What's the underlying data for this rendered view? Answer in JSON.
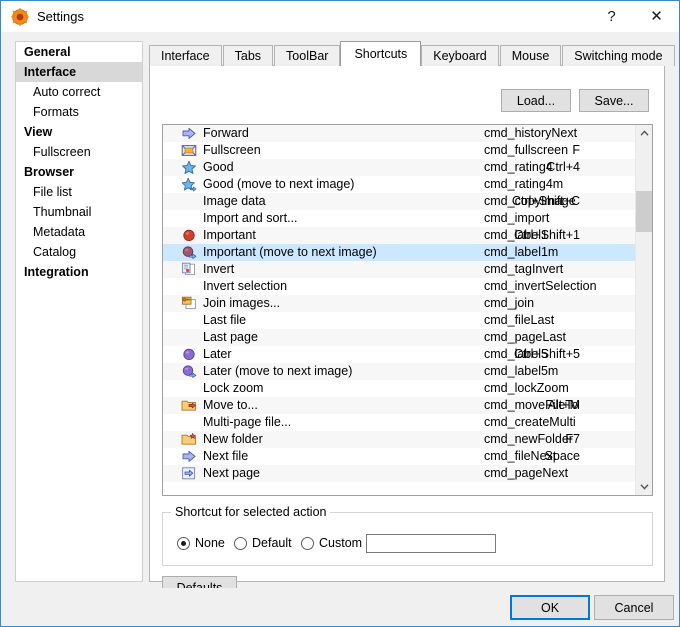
{
  "window": {
    "title": "Settings",
    "icon": "settings-gear-icon",
    "help_label": "?",
    "close_label": "✕",
    "accent": "#0078d7",
    "titlebar_bg": "#ffffff",
    "dialog_bg": "#f0f0f0"
  },
  "sidebar": {
    "items": [
      {
        "label": "General",
        "type": "category",
        "selected": false
      },
      {
        "label": "Interface",
        "type": "category",
        "selected": true
      },
      {
        "label": "Auto correct",
        "type": "child",
        "selected": false
      },
      {
        "label": "Formats",
        "type": "child",
        "selected": false
      },
      {
        "label": "View",
        "type": "category",
        "selected": false
      },
      {
        "label": "Fullscreen",
        "type": "child",
        "selected": false
      },
      {
        "label": "Browser",
        "type": "category",
        "selected": false
      },
      {
        "label": "File list",
        "type": "child",
        "selected": false
      },
      {
        "label": "Thumbnail",
        "type": "child",
        "selected": false
      },
      {
        "label": "Metadata",
        "type": "child",
        "selected": false
      },
      {
        "label": "Catalog",
        "type": "child",
        "selected": false
      },
      {
        "label": "Integration",
        "type": "category",
        "selected": false
      }
    ],
    "selected_bg": "#d8d8d8"
  },
  "tabs": {
    "items": [
      {
        "label": "Interface",
        "active": false
      },
      {
        "label": "Tabs",
        "active": false
      },
      {
        "label": "ToolBar",
        "active": false
      },
      {
        "label": "Shortcuts",
        "active": true
      },
      {
        "label": "Keyboard",
        "active": false
      },
      {
        "label": "Mouse",
        "active": false
      },
      {
        "label": "Switching mode",
        "active": false
      }
    ]
  },
  "toolbar": {
    "load_label": "Load...",
    "save_label": "Save..."
  },
  "shortcut_list": {
    "selected_index": 7,
    "selected_bg": "#cce8ff",
    "rows": [
      {
        "name": "Forward",
        "key": "",
        "cmd": "cmd_historyNext",
        "icon": "right-arrow-icon"
      },
      {
        "name": "Fullscreen",
        "key": "F",
        "cmd": "cmd_fullscreen",
        "icon": "fullscreen-icon"
      },
      {
        "name": "Good",
        "key": "Ctrl+4",
        "cmd": "cmd_rating4",
        "icon": "star-icon"
      },
      {
        "name": "Good (move to next image)",
        "key": "",
        "cmd": "cmd_rating4m",
        "icon": "star-next-icon"
      },
      {
        "name": "Image data",
        "key": "Ctrl+Shift+C",
        "cmd": "cmd_copyImage",
        "icon": "none"
      },
      {
        "name": "Import and sort...",
        "key": "",
        "cmd": "cmd_import",
        "icon": "none"
      },
      {
        "name": "Important",
        "key": "Ctrl+Shift+1",
        "cmd": "cmd_label1",
        "icon": "red-dot-icon"
      },
      {
        "name": "Important (move to next image)",
        "key": "",
        "cmd": "cmd_label1m",
        "icon": "red-dot-next-icon"
      },
      {
        "name": "Invert",
        "key": "",
        "cmd": "cmd_tagInvert",
        "icon": "invert-tag-icon"
      },
      {
        "name": "Invert selection",
        "key": "",
        "cmd": "cmd_invertSelection",
        "icon": "none"
      },
      {
        "name": "Join images...",
        "key": "",
        "cmd": "cmd_join",
        "icon": "join-images-icon"
      },
      {
        "name": "Last file",
        "key": "",
        "cmd": "cmd_fileLast",
        "icon": "none"
      },
      {
        "name": "Last page",
        "key": "",
        "cmd": "cmd_pageLast",
        "icon": "none"
      },
      {
        "name": "Later",
        "key": "Ctrl+Shift+5",
        "cmd": "cmd_label5",
        "icon": "purple-dot-icon"
      },
      {
        "name": "Later (move to next image)",
        "key": "",
        "cmd": "cmd_label5m",
        "icon": "purple-dot-next-icon"
      },
      {
        "name": "Lock zoom",
        "key": "",
        "cmd": "cmd_lockZoom",
        "icon": "none"
      },
      {
        "name": "Move to...",
        "key": "Alt+M",
        "cmd": "cmd_moveFileTo",
        "icon": "move-folder-icon"
      },
      {
        "name": "Multi-page file...",
        "key": "",
        "cmd": "cmd_createMulti",
        "icon": "none"
      },
      {
        "name": "New folder",
        "key": "F7",
        "cmd": "cmd_newFolder",
        "icon": "new-folder-icon"
      },
      {
        "name": "Next file",
        "key": "Space",
        "cmd": "cmd_fileNext",
        "icon": "right-arrow-icon"
      },
      {
        "name": "Next page",
        "key": "",
        "cmd": "cmd_pageNext",
        "icon": "next-page-icon"
      }
    ]
  },
  "scrollbar": {
    "up_glyph": "▲",
    "down_glyph": "▼"
  },
  "shortcut_group": {
    "legend": "Shortcut for selected action",
    "options": [
      {
        "label": "None",
        "selected": true
      },
      {
        "label": "Default",
        "selected": false
      },
      {
        "label": "Custom",
        "selected": false
      }
    ],
    "custom_value": "",
    "custom_placeholder": ""
  },
  "buttons": {
    "defaults_label": "Defaults",
    "ok_label": "OK",
    "cancel_label": "Cancel"
  }
}
